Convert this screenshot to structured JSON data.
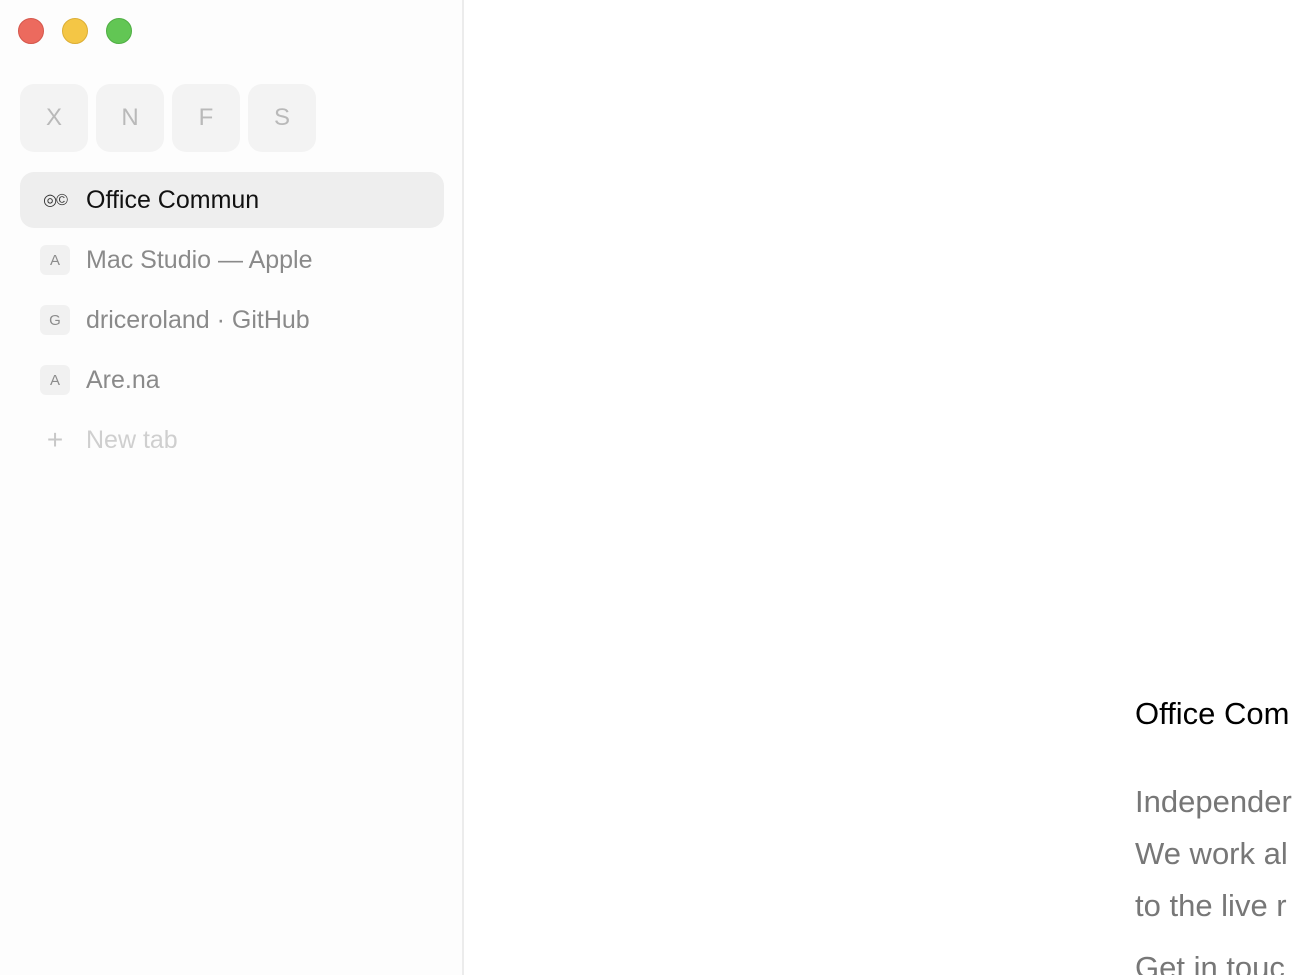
{
  "window": {
    "controls": [
      "close",
      "minimize",
      "zoom"
    ]
  },
  "sidebar": {
    "pinned": [
      {
        "letter": "X"
      },
      {
        "letter": "N"
      },
      {
        "letter": "F"
      },
      {
        "letter": "S"
      }
    ],
    "tabs": [
      {
        "favicon": "◎©",
        "title": "Office Commun",
        "active": true
      },
      {
        "favicon": "A",
        "title": "Mac Studio — Apple",
        "active": false
      },
      {
        "favicon": "G",
        "title": "driceroland · GitHub",
        "active": false
      },
      {
        "favicon": "A",
        "title": "Are.na",
        "active": false
      }
    ],
    "new_tab": {
      "icon": "+",
      "label": "New tab"
    }
  },
  "content": {
    "title": "Office Com",
    "body_lines": [
      "Independer",
      "We work al",
      "to the live r"
    ],
    "contact": "Get in touc"
  },
  "colors": {
    "close": "#ec6a5e",
    "minimize": "#f4c645",
    "zoom": "#62c654",
    "active_tab": "#eeeeee"
  }
}
